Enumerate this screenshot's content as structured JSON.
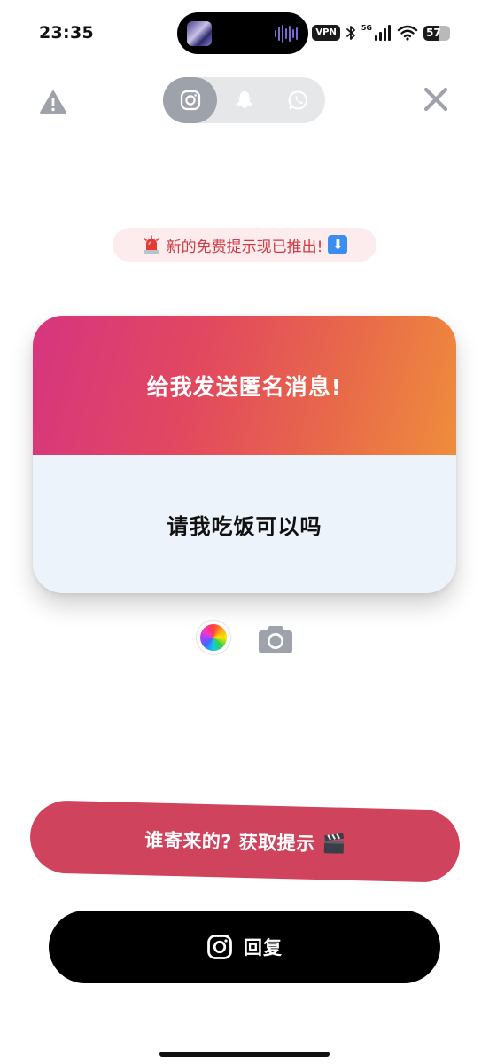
{
  "status_bar": {
    "time": "23:35",
    "vpn": "VPN",
    "network": "5G",
    "battery": "57",
    "battery_level": 0.57
  },
  "toolbar": {
    "warning_icon": "warning-triangle-icon",
    "close_icon": "close-x-icon",
    "platform_tabs": [
      {
        "name": "instagram",
        "icon": "instagram-icon",
        "active": true
      },
      {
        "name": "snapchat",
        "icon": "snapchat-ghost-icon",
        "active": false
      },
      {
        "name": "whatsapp",
        "icon": "whatsapp-icon",
        "active": false
      }
    ]
  },
  "announcement": {
    "text": "新的免费提示现已推出!",
    "leading_icon": "siren-emoji",
    "trailing_icon": "down-arrow-emoji"
  },
  "card": {
    "title": "给我发送匿名消息!",
    "message": "请我吃饭可以吗",
    "gradient_colors": [
      "#d6357f",
      "#ef8d3c"
    ]
  },
  "tools": {
    "color_picker_icon": "color-wheel-icon",
    "camera_icon": "camera-icon"
  },
  "buttons": {
    "hint": "谁寄来的? 获取提示",
    "hint_icon": "clapper-board-emoji",
    "reply": "回复",
    "reply_icon": "instagram-icon"
  },
  "colors": {
    "hint_button": "#d0435c",
    "reply_button": "#000000",
    "announcement_text": "#cf3a44"
  }
}
